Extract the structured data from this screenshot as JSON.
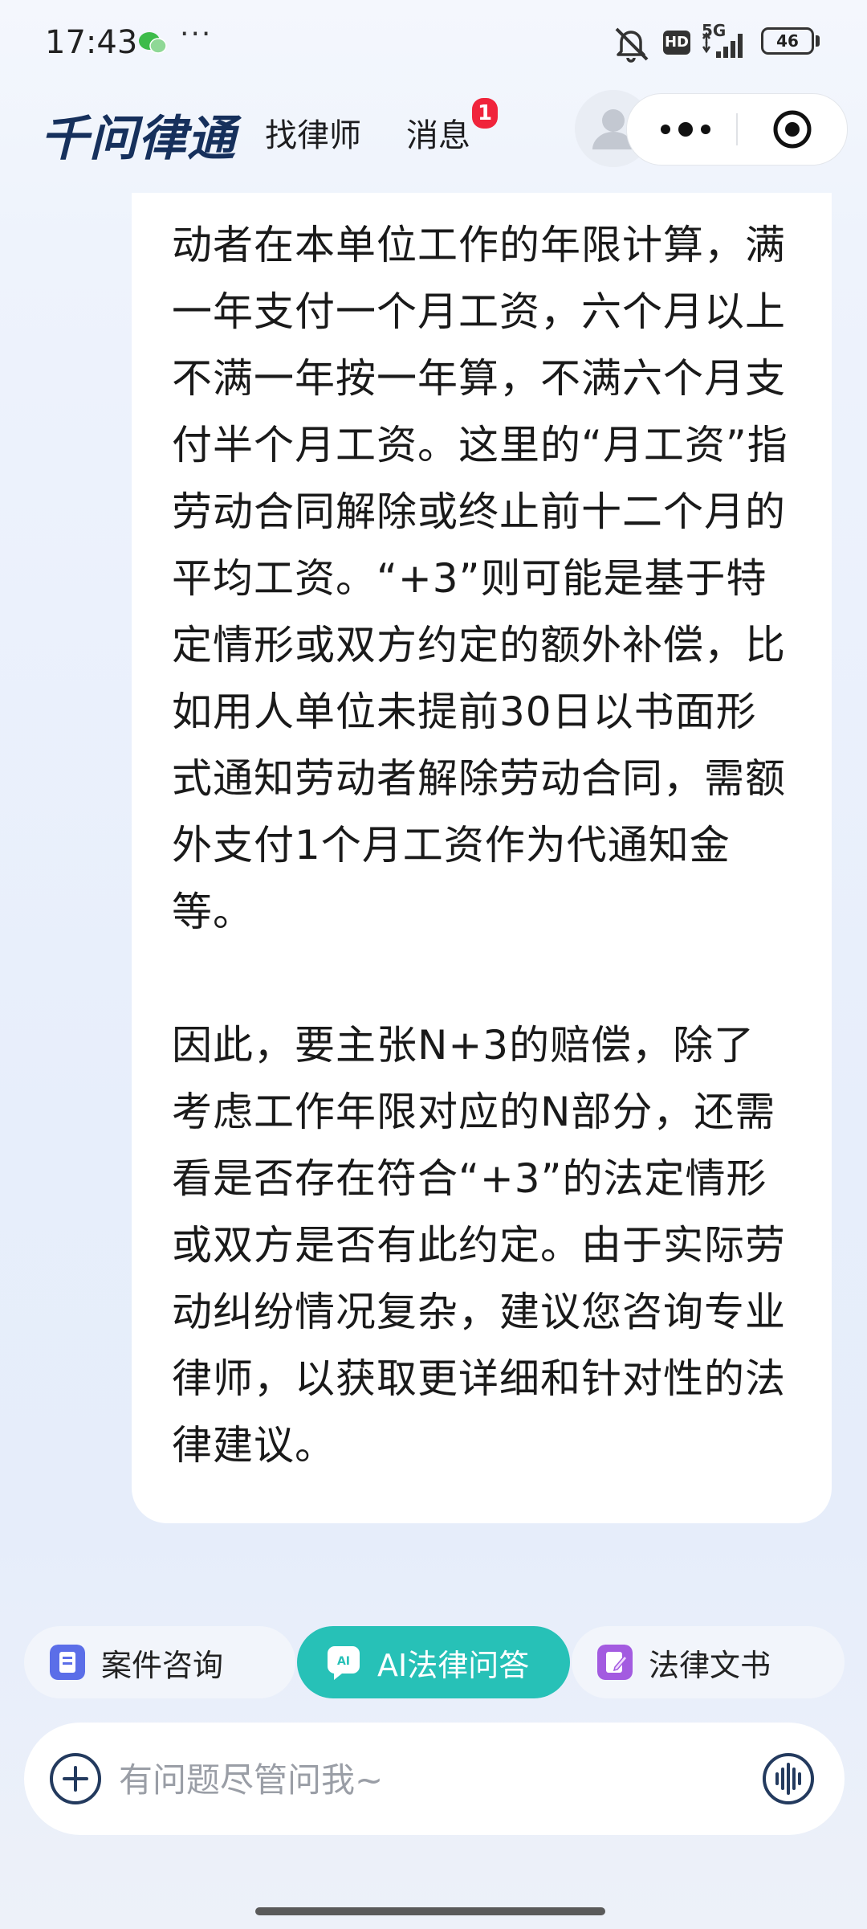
{
  "status_bar": {
    "time": "17:43",
    "dots": "···",
    "network": "5G",
    "hd": "HD",
    "battery": "46",
    "icons": [
      "wechat-icon",
      "mute-icon",
      "hd-icon",
      "signal-icon",
      "battery-icon"
    ]
  },
  "header": {
    "brand": "千问律通",
    "nav_find_lawyer": "找律师",
    "nav_messages": "消息",
    "messages_badge": "1",
    "icons": [
      "avatar-icon",
      "more-icon",
      "close-target-icon"
    ]
  },
  "answer": {
    "paragraphs": [
      "动者在本单位工作的年限计算，满一年支付一个月工资，六个月以上不满一年按一年算，不满六个月支付半个月工资。这里的“月工资”指劳动合同解除或终止前十二个月的平均工资。“+3”则可能是基于特定情形或双方约定的额外补偿，比如用人单位未提前30日以书面形式通知劳动者解除劳动合同，需额外支付1个月工资作为代通知金等。",
      "因此，要主张N+3的赔偿，除了考虑工作年限对应的N部分，还需看是否存在符合“+3”的法定情形或双方是否有此约定。由于实际劳动纠纷情况复杂，建议您咨询专业律师，以获取更详细和针对性的法律建议。"
    ]
  },
  "tabs": [
    {
      "label": "案件咨询",
      "icon": "case-icon",
      "color": "#5b6ee8",
      "active": false
    },
    {
      "label": "AI法律问答",
      "icon": "ai-chat-icon",
      "color": "#27c1b7",
      "active": true
    },
    {
      "label": "法律文书",
      "icon": "document-icon",
      "color": "#a35be0",
      "active": false
    }
  ],
  "input": {
    "placeholder": "有问题尽管问我~",
    "value": "",
    "icons": [
      "plus-icon",
      "voice-icon"
    ]
  },
  "colors": {
    "brand": "#16305c",
    "accent": "#27c1b7",
    "badge": "#f0243b"
  }
}
